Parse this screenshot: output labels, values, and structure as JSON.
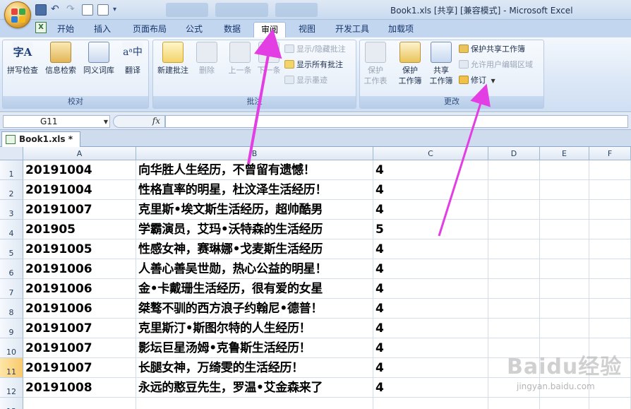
{
  "window": {
    "title": "Book1.xls  [共享]  [兼容模式] - Microsoft Excel"
  },
  "ribbon_tabs": [
    {
      "label": "开始",
      "active": false
    },
    {
      "label": "插入",
      "active": false
    },
    {
      "label": "页面布局",
      "active": false
    },
    {
      "label": "公式",
      "active": false
    },
    {
      "label": "数据",
      "active": false
    },
    {
      "label": "审阅",
      "active": true
    },
    {
      "label": "视图",
      "active": false
    },
    {
      "label": "开发工具",
      "active": false
    },
    {
      "label": "加载项",
      "active": false
    }
  ],
  "ribbon": {
    "proofing": {
      "label": "校对",
      "buttons": [
        "拼写检查",
        "信息检索",
        "同义词库",
        "翻译"
      ]
    },
    "comments": {
      "label": "批注",
      "buttons": [
        "新建批注",
        "删除",
        "上一条",
        "下一条"
      ],
      "small": [
        "显示/隐藏批注",
        "显示所有批注",
        "显示墨迹"
      ]
    },
    "changes": {
      "label": "更改",
      "big": [
        {
          "line1": "保护",
          "line2": "工作表"
        },
        {
          "line1": "保护",
          "line2": "工作簿"
        },
        {
          "line1": "共享",
          "line2": "工作簿"
        }
      ],
      "small": [
        "保护共享工作簿",
        "允许用户编辑区域",
        "修订"
      ]
    }
  },
  "formula_bar": {
    "name_box": "G11",
    "fx": "fx",
    "value": ""
  },
  "workbook_tab": "Book1.xls *",
  "columns": [
    "A",
    "B",
    "C",
    "D",
    "E",
    "F"
  ],
  "rows": [
    {
      "num": "1",
      "a": "20191004",
      "b": "向华胜人生经历，不曾留有遗憾！",
      "c": "4"
    },
    {
      "num": "2",
      "a": "20191004",
      "b": "性格直率的明星，杜汶泽生活经历！",
      "c": "4"
    },
    {
      "num": "3",
      "a": "20191007",
      "b": "克里斯•埃文斯生活经历，超帅酷男",
      "c": "4"
    },
    {
      "num": "4",
      "a": "201905",
      "b": "学霸演员，艾玛•沃特森的生活经历",
      "c": "5"
    },
    {
      "num": "5",
      "a": "20191005",
      "b": "性感女神，赛琳娜•戈麦斯生活经历",
      "c": "4"
    },
    {
      "num": "6",
      "a": "20191006",
      "b": "人善心善吴世勋，热心公益的明星！",
      "c": "4"
    },
    {
      "num": "7",
      "a": "20191006",
      "b": "金•卡戴珊生活经历，很有爱的女星",
      "c": "4"
    },
    {
      "num": "8",
      "a": "20191006",
      "b": "桀骜不驯的西方浪子约翰尼•德普！",
      "c": "4"
    },
    {
      "num": "9",
      "a": "20191007",
      "b": "克里斯汀•斯图尔特的人生经历！",
      "c": "4"
    },
    {
      "num": "10",
      "a": "20191007",
      "b": "影坛巨星汤姆•克鲁斯生活经历！",
      "c": "4"
    },
    {
      "num": "11",
      "a": "20191007",
      "b": "长腿女神，万绮雯的生活经历！",
      "c": "4"
    },
    {
      "num": "12",
      "a": "20191008",
      "b": "永远的憨豆先生，罗温•艾金森来了",
      "c": "4"
    },
    {
      "num": "13",
      "a": "",
      "b": "",
      "c": ""
    }
  ],
  "selected_row": "11",
  "colors": {
    "arrow": "#e23ee4",
    "ribbon_bg": "#dbe7f6",
    "active_row_header": "#f9c96b"
  },
  "watermark": {
    "text": "Baidu经验",
    "url": "jingyan.baidu.com"
  }
}
